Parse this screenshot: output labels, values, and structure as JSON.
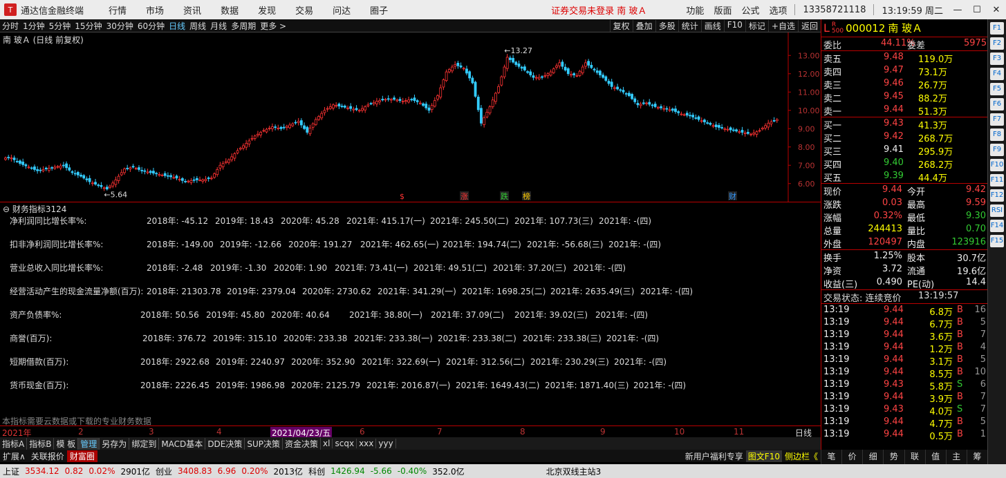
{
  "titlebar": {
    "app_name": "通达信金融终端",
    "menu": [
      "行情",
      "市场",
      "资讯",
      "数据",
      "发现",
      "交易",
      "问达",
      "圈子"
    ],
    "notice": "证券交易未登录  南 玻Ａ",
    "right": [
      "功能",
      "版面",
      "公式",
      "选项"
    ],
    "phone": "13358721118",
    "clock": "13:19:59 周二"
  },
  "toolbar": {
    "periods": [
      "分时",
      "1分钟",
      "5分钟",
      "15分钟",
      "30分钟",
      "60分钟",
      "日线",
      "周线",
      "月线",
      "多周期",
      "更多 >"
    ],
    "active_period": "日线",
    "actions": [
      "复权",
      "叠加",
      "多股",
      "统计",
      "画线",
      "F10",
      "标记",
      "+自选",
      "返回"
    ]
  },
  "chart": {
    "title": "南 玻Ａ (日线 前复权)",
    "y_ticks": [
      "13.00",
      "12.00",
      "11.00",
      "10.00",
      "9.00",
      "8.00",
      "7.00",
      "6.00"
    ],
    "high_label": "13.27",
    "low_label": "5.64",
    "markers": [
      "$",
      "涨",
      "跌",
      "榜",
      "财"
    ]
  },
  "chart_data": {
    "type": "candlestick",
    "ylim": [
      5.5,
      13.5
    ],
    "series": [
      {
        "name": "close",
        "values": [
          7.4,
          7.1,
          6.9,
          6.7,
          6.8,
          6.9,
          7.0,
          6.6,
          6.4,
          6.1,
          5.9,
          5.7,
          6.2,
          6.8,
          6.9,
          6.7,
          6.6,
          6.5,
          6.4,
          6.3,
          6.1,
          6.2,
          6.2,
          6.3,
          7.0,
          7.3,
          7.8,
          8.2,
          8.6,
          8.9,
          9.1,
          9.0,
          9.2,
          9.4,
          8.8,
          9.5,
          10.0,
          10.3,
          10.2,
          10.1,
          10.0,
          10.3,
          10.5,
          10.6,
          10.6,
          10.5,
          10.6,
          10.4,
          10.0,
          10.8,
          12.1,
          12.5,
          12.3,
          11.5,
          9.3,
          10.2,
          11.3,
          12.9,
          12.5,
          12.2,
          11.8,
          11.8,
          12.1,
          12.6,
          12.0,
          11.9,
          12.6,
          12.2,
          11.8,
          11.3,
          11.1,
          10.8,
          10.3,
          10.4,
          10.2,
          10.1,
          10.0,
          9.8,
          9.7,
          9.5,
          9.3,
          9.1,
          9.0,
          8.9,
          8.8,
          8.7,
          8.9,
          9.3,
          9.5
        ]
      }
    ]
  },
  "fin": {
    "title": "财务指标3124",
    "rows": [
      {
        "label": "净利润同比增长率%:",
        "cells": [
          "2018年: -45.12",
          "2019年: 18.43",
          "2020年: 45.28",
          "2021年: 415.17(一)",
          "2021年: 245.50(二)",
          "2021年: 107.73(三)",
          "2021年: -(四)"
        ]
      },
      {
        "label": "扣非净利润同比增长率%:",
        "cells": [
          "2018年: -149.00",
          "2019年: -12.66",
          "2020年: 191.27",
          "2021年: 462.65(一)",
          "2021年: 194.74(二)",
          "2021年: -56.68(三)",
          "2021年: -(四)"
        ]
      },
      {
        "label": "营业总收入同比增长率%:",
        "cells": [
          "2018年: -2.48",
          "2019年: -1.30",
          "2020年: 1.90",
          "2021年: 73.41(一)",
          "2021年: 49.51(二)",
          "2021年: 37.20(三)",
          "2021年: -(四)"
        ]
      },
      {
        "label": "经营活动产生的现金流量净额(百万):",
        "cells": [
          "2018年: 21303.78",
          "2019年: 2379.04",
          "2020年: 2730.62",
          "2021年: 341.29(一)",
          "2021年: 1698.25(二)",
          "2021年: 2635.49(三)",
          "2021年: -(四)"
        ]
      },
      {
        "label": "资产负债率%:",
        "cells": [
          "2018年: 50.56",
          "2019年: 45.80",
          "2020年: 40.64",
          "2021年: 38.80(一)",
          "2021年: 37.09(二)",
          "2021年: 39.02(三)",
          "2021年: -(四)"
        ]
      },
      {
        "label": "商誉(百万):",
        "cells": [
          "2018年: 376.72",
          "2019年: 315.10",
          "2020年: 233.38",
          "2021年: 233.38(一)",
          "2021年: 233.38(二)",
          "2021年: 233.38(三)",
          "2021年: -(四)"
        ]
      },
      {
        "label": "短期借款(百万):",
        "cells": [
          "2018年: 2922.68",
          "2019年: 2240.97",
          "2020年: 352.90",
          "2021年: 322.69(一)",
          "2021年: 312.56(二)",
          "2021年: 230.29(三)",
          "2021年: -(四)"
        ]
      },
      {
        "label": "货币现金(百万):",
        "cells": [
          "2018年: 2226.45",
          "2019年: 1986.98",
          "2020年: 2125.79",
          "2021年: 2016.87(一)",
          "2021年: 1649.43(二)",
          "2021年: 1871.40(三)",
          "2021年: -(四)"
        ]
      }
    ],
    "note": "本指标需要云数据或下载的专业财务数据"
  },
  "dateaxis": {
    "labels": [
      "2021年",
      "2",
      "3",
      "4",
      "2021/04/23/五",
      "6",
      "7",
      "8",
      "9",
      "10",
      "11"
    ],
    "period": "日线"
  },
  "tabs1": [
    "指标A",
    "指标B",
    "模 板",
    "管理",
    "另存为",
    "绑定到",
    "MACD基本",
    "DDE决策",
    "SUP决策",
    "资金决策",
    "xl",
    "scqx",
    "xxx",
    "yyy"
  ],
  "tabs1_active": "管理",
  "tabs2": {
    "items": [
      "扩展∧",
      "关联报价",
      "财富圈"
    ],
    "ad": "新用户福利专享",
    "f10": "图文F10",
    "side": "侧边栏《"
  },
  "status": {
    "items": [
      {
        "name": "上证",
        "price": "3534.12",
        "chg": "0.82",
        "pct": "0.02%",
        "amt": "2901亿",
        "dir": "up"
      },
      {
        "name": "创业",
        "price": "3408.83",
        "chg": "6.96",
        "pct": "0.20%",
        "amt": "2013亿",
        "dir": "up"
      },
      {
        "name": "科创",
        "price": "1426.94",
        "chg": "-5.66",
        "pct": "-0.40%",
        "amt": "352.0亿",
        "dir": "dn"
      }
    ],
    "server": "北京双线主站3"
  },
  "quote": {
    "code": "000012",
    "name": "南 玻Ａ",
    "weibi_label": "委比",
    "weibi": "44.11%",
    "weicha_label": "委差",
    "weicha": "5975",
    "sell": [
      {
        "label": "卖五",
        "price": "9.48",
        "vol": "119.0万"
      },
      {
        "label": "卖四",
        "price": "9.47",
        "vol": "73.1万"
      },
      {
        "label": "卖三",
        "price": "9.46",
        "vol": "26.7万"
      },
      {
        "label": "卖二",
        "price": "9.45",
        "vol": "88.2万"
      },
      {
        "label": "卖一",
        "price": "9.44",
        "vol": "51.3万"
      }
    ],
    "buy": [
      {
        "label": "买一",
        "price": "9.43",
        "vol": "41.3万",
        "c": "red"
      },
      {
        "label": "买二",
        "price": "9.42",
        "vol": "268.7万",
        "c": "red"
      },
      {
        "label": "买三",
        "price": "9.41",
        "vol": "295.9万",
        "c": "wht"
      },
      {
        "label": "买四",
        "price": "9.40",
        "vol": "268.2万",
        "c": "grn"
      },
      {
        "label": "买五",
        "price": "9.39",
        "vol": "44.4万",
        "c": "grn"
      }
    ],
    "stats": [
      {
        "l1": "现价",
        "v1": "9.44",
        "c1": "red",
        "l2": "今开",
        "v2": "9.42",
        "c2": "red"
      },
      {
        "l1": "涨跌",
        "v1": "0.03",
        "c1": "red",
        "l2": "最高",
        "v2": "9.59",
        "c2": "red"
      },
      {
        "l1": "涨幅",
        "v1": "0.32%",
        "c1": "red",
        "l2": "最低",
        "v2": "9.30",
        "c2": "grn"
      },
      {
        "l1": "总量",
        "v1": "244413",
        "c1": "yel",
        "l2": "量比",
        "v2": "0.70",
        "c2": "grn"
      },
      {
        "l1": "外盘",
        "v1": "120497",
        "c1": "red",
        "l2": "内盘",
        "v2": "123916",
        "c2": "grn"
      }
    ],
    "stats2": [
      {
        "l1": "换手",
        "v1": "1.25%",
        "l2": "股本",
        "v2": "30.7亿"
      },
      {
        "l1": "净资",
        "v1": "3.72",
        "l2": "流通",
        "v2": "19.6亿"
      },
      {
        "l1": "收益(三)",
        "v1": "0.490",
        "l2": "PE(动)",
        "v2": "14.4"
      }
    ],
    "trade_state": "交易状态: 连续竞价",
    "trade_time": "13:19:57",
    "ticks": [
      {
        "t": "13:19",
        "p": "9.44",
        "v": "6.8万",
        "s": "B",
        "n": "16",
        "pc": "red"
      },
      {
        "t": "13:19",
        "p": "9.44",
        "v": "6.7万",
        "s": "B",
        "n": "5",
        "pc": "red"
      },
      {
        "t": "13:19",
        "p": "9.44",
        "v": "3.6万",
        "s": "B",
        "n": "7",
        "pc": "red"
      },
      {
        "t": "13:19",
        "p": "9.44",
        "v": "1.2万",
        "s": "B",
        "n": "4",
        "pc": "red"
      },
      {
        "t": "13:19",
        "p": "9.44",
        "v": "3.1万",
        "s": "B",
        "n": "5",
        "pc": "red"
      },
      {
        "t": "13:19",
        "p": "9.44",
        "v": "8.5万",
        "s": "B",
        "n": "10",
        "pc": "red"
      },
      {
        "t": "13:19",
        "p": "9.43",
        "v": "5.8万",
        "s": "S",
        "n": "6",
        "pc": "red"
      },
      {
        "t": "13:19",
        "p": "9.44",
        "v": "3.9万",
        "s": "B",
        "n": "7",
        "pc": "red"
      },
      {
        "t": "13:19",
        "p": "9.43",
        "v": "4.0万",
        "s": "S",
        "n": "7",
        "pc": "red"
      },
      {
        "t": "13:19",
        "p": "9.44",
        "v": "4.7万",
        "s": "B",
        "n": "5",
        "pc": "red"
      },
      {
        "t": "13:19",
        "p": "9.44",
        "v": "0.5万",
        "s": "B",
        "n": "1",
        "pc": "red"
      }
    ],
    "tabs": [
      "笔",
      "价",
      "细",
      "势",
      "联",
      "值",
      "主",
      "筹"
    ]
  },
  "side_icons": [
    "F1",
    "F2",
    "F3",
    "F4",
    "F5",
    "F6",
    "F7",
    "F8",
    "F9",
    "F10",
    "F11",
    "F12",
    "RSI",
    "F14",
    "F15"
  ]
}
